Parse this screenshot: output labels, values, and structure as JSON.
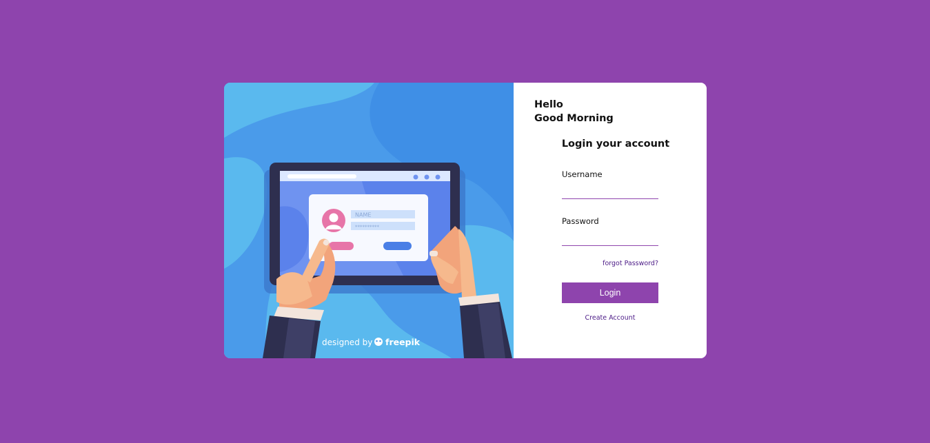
{
  "colors": {
    "background": "#8e44ad",
    "accent": "#8e44ad",
    "link": "#4b1a86",
    "illustration_bg": "#4a9bea"
  },
  "illustration": {
    "name_placeholder": "NAME",
    "password_placeholder": "**********",
    "credit_prefix": "designed by",
    "credit_brand": "freepik"
  },
  "greeting": {
    "line1": "Hello",
    "line2": "Good Morning"
  },
  "form": {
    "title": "Login your account",
    "username_label": "Username",
    "username_value": "",
    "password_label": "Password",
    "password_value": "",
    "forgot_label": "forgot Password?",
    "login_label": "Login",
    "create_label": "Create Account"
  }
}
